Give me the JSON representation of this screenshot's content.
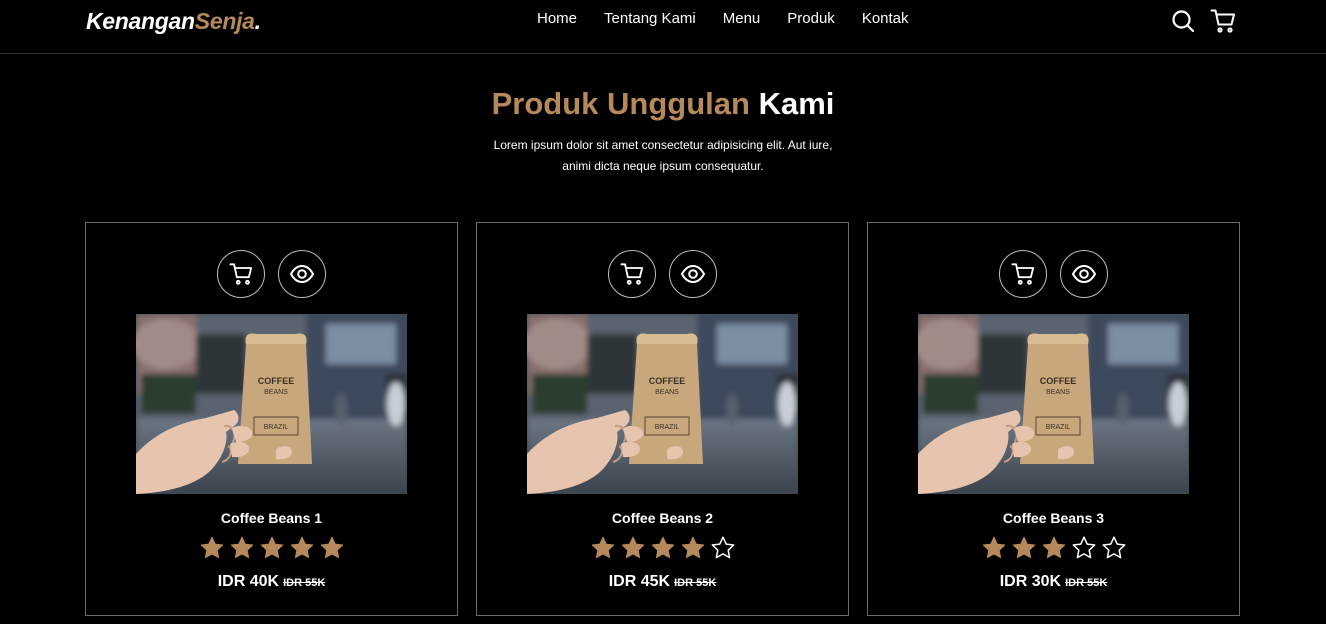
{
  "brand": {
    "name": "Kenangan",
    "accent": "Senja",
    "dot": "."
  },
  "nav": {
    "links": [
      "Home",
      "Tentang Kami",
      "Menu",
      "Produk",
      "Kontak"
    ],
    "icons": [
      "search-icon",
      "cart-icon"
    ]
  },
  "section": {
    "title_accent": "Produk Unggulan",
    "title_rest": "Kami",
    "description": "Lorem ipsum dolor sit amet consectetur adipisicing elit. Aut iure, animi dicta neque ipsum consequatur."
  },
  "colors": {
    "accent": "#b6895b",
    "background": "#000000",
    "text": "#ffffff"
  },
  "products": [
    {
      "name": "Coffee Beans 1",
      "rating": 5,
      "max_rating": 5,
      "price": "IDR 40K",
      "old_price": "IDR 55K"
    },
    {
      "name": "Coffee Beans 2",
      "rating": 4,
      "max_rating": 5,
      "price": "IDR 45K",
      "old_price": "IDR 55K"
    },
    {
      "name": "Coffee Beans 3",
      "rating": 3,
      "max_rating": 5,
      "price": "IDR 30K",
      "old_price": "IDR 55K"
    }
  ],
  "card_actions": [
    "cart-icon",
    "eye-icon"
  ],
  "product_image": {
    "bag_text_1": "COFFEE",
    "bag_text_2": "BEANS",
    "bag_label": "BRAZIL"
  }
}
